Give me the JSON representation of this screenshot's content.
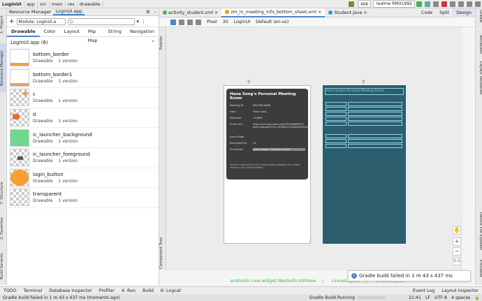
{
  "topbar": {
    "crumbs": [
      "LoginUI",
      "app",
      "src",
      "main",
      "res",
      "drawable"
    ],
    "run_config": "app",
    "device": "realme RMX1992"
  },
  "left_tabs": {
    "project": "1: Project",
    "resource_manager": "Resource Manager",
    "structure": "7: Structure",
    "favorites": "2: Favorites",
    "build_variants": "Build Variants"
  },
  "right_tabs": {
    "gradle": "Gradle",
    "attributes": "Attributes",
    "layout_validation": "Layout Validation",
    "device_file_explorer": "Device File Explorer",
    "emulator": "Emulator"
  },
  "resource_manager": {
    "tab_title": "Resource Manager",
    "tab_file": "LoginUI.app",
    "module_label": "Module: LoginUI.a",
    "search_placeholder": "Q-",
    "categories": [
      "Drawable",
      "Color",
      "Layout",
      "Mip Map",
      "String",
      "Navigation"
    ],
    "group_title": "LoginUI.app (8)",
    "items": [
      {
        "name": "bottom_border",
        "type": "Drawable",
        "versions": "1 version",
        "thumb": "bottom"
      },
      {
        "name": "bottom_border1",
        "type": "Drawable",
        "versions": "1 version",
        "thumb": "bottom1"
      },
      {
        "name": "c",
        "type": "Drawable",
        "versions": "1 version",
        "thumb": "c"
      },
      {
        "name": "d",
        "type": "Drawable",
        "versions": "1 version",
        "thumb": "d"
      },
      {
        "name": "ic_launcher_background",
        "type": "Drawable",
        "versions": "1 version",
        "thumb": "green"
      },
      {
        "name": "ic_launcher_foreground",
        "type": "Drawable",
        "versions": "1 version",
        "thumb": "fg"
      },
      {
        "name": "login_button",
        "type": "Drawable",
        "versions": "1 version",
        "thumb": "orange"
      },
      {
        "name": "transparent",
        "type": "Drawable",
        "versions": "1 version",
        "thumb": "checker"
      }
    ]
  },
  "editor": {
    "tabs": [
      {
        "label": "activity_student.xml",
        "color": "#4caf50"
      },
      {
        "label": "zm_in_meeting_info_bottom_sheet.xml",
        "color": "#ff9800"
      },
      {
        "label": "Student.java",
        "color": "#2196f3"
      }
    ],
    "view_modes": [
      "Code",
      "Split",
      "Design"
    ],
    "toolbar": {
      "device": "Pixel",
      "api": "30",
      "theme": "LoginUI",
      "locale": "Default (en-us)"
    },
    "palette": "Palette",
    "component_tree": "Component Tree",
    "breadcrumb": [
      "androidx.core.widget.NestedScrollView",
      "LinearLayout",
      "LinearLayout"
    ]
  },
  "preview": {
    "title": "Hana Song's Personal Meeting Room",
    "rows": [
      {
        "label": "Meeting ID",
        "value": "880 966 6688"
      },
      {
        "label": "Host",
        "value": "Hana Song"
      },
      {
        "label": "Passcode",
        "value": "124699"
      },
      {
        "label": "Invite Link",
        "value": "https://success.zoom.us/j/92300868507?pwd=8dpqp037cc1145Zwv12Zdoh4d29bd2zl9"
      },
      {
        "label": "Event Page",
        "value": ""
      },
      {
        "label": "Participant ID",
        "value": "19"
      },
      {
        "label": "Encryption",
        "value": "room.google...Flexbox Layout"
      }
    ],
    "footer": "You are connected to the Zoom global network via a data center in the United States."
  },
  "toast": "Gradle build failed in 1 m 43 s 437 ms",
  "bottom_tools": [
    "TODO",
    "Terminal",
    "Database Inspector",
    "Profiler",
    "4: Run",
    "Build",
    "6: Logcat",
    "Event Log",
    "Layout Inspector"
  ],
  "status": {
    "message": "Gradle build failed in 1 m 43 s 437 ms (moments ago)",
    "task": "Gradle Build Running",
    "position": "21:41",
    "line_sep": "LF",
    "encoding": "UTF-8",
    "indent": "4 spaces"
  }
}
